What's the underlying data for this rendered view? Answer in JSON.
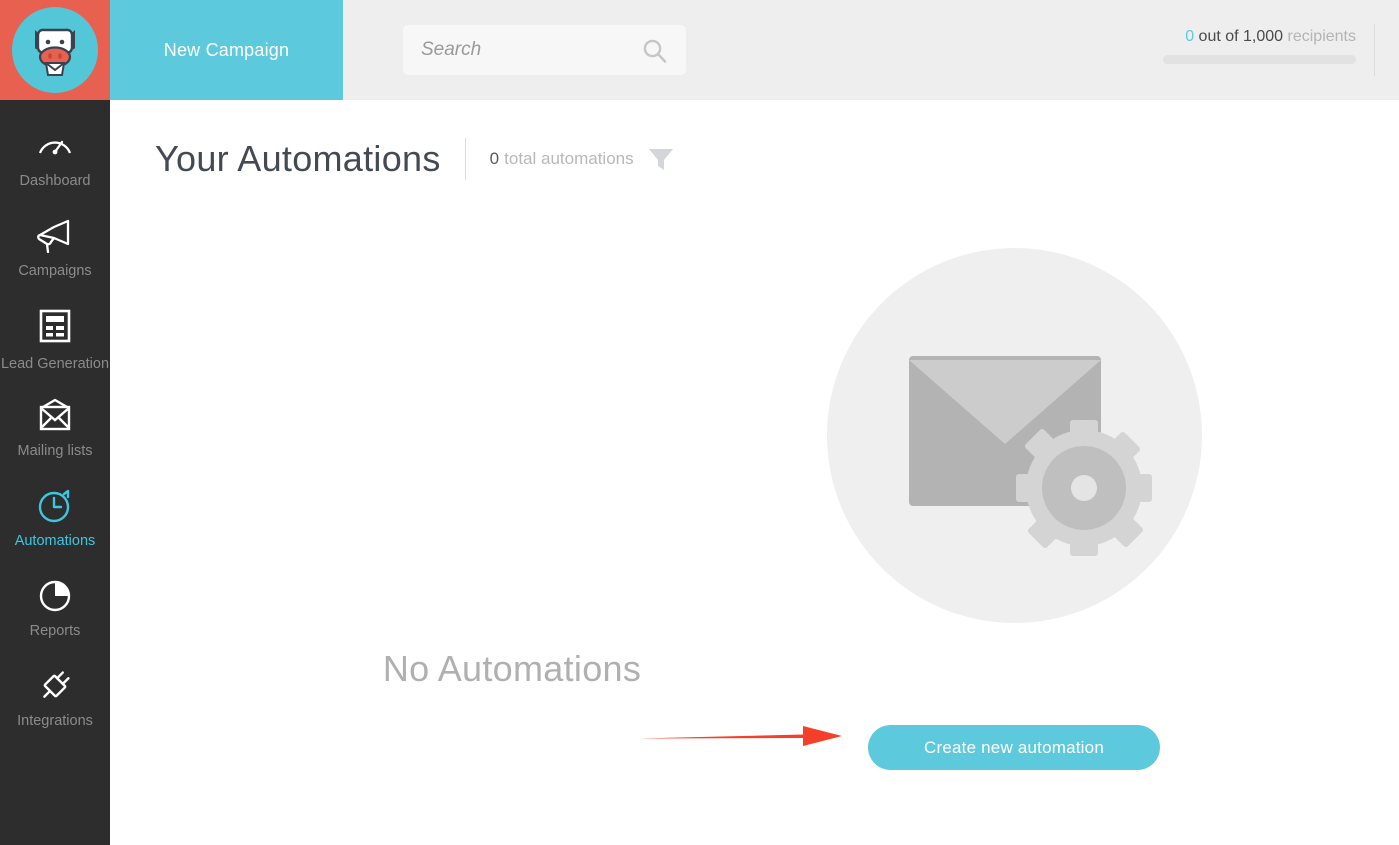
{
  "header": {
    "logo": {
      "icon": "cow-mascot-logo",
      "alt": "Moosend cow logo"
    },
    "new_campaign_label": "New Campaign",
    "search": {
      "placeholder": "Search",
      "value": "",
      "icon": "search-icon"
    },
    "recipients": {
      "count": "0",
      "middle": " out of 1,000 ",
      "unit": "recipients",
      "progress_percent": 0
    }
  },
  "sidebar": {
    "items": [
      {
        "label": "Dashboard",
        "icon": "speedometer-icon",
        "active": false
      },
      {
        "label": "Campaigns",
        "icon": "megaphone-icon",
        "active": false
      },
      {
        "label": "Lead Generation",
        "icon": "form-icon",
        "active": false
      },
      {
        "label": "Mailing lists",
        "icon": "envelope-icon",
        "active": false
      },
      {
        "label": "Automations",
        "icon": "stopwatch-icon",
        "active": true
      },
      {
        "label": "Reports",
        "icon": "pie-chart-icon",
        "active": false
      },
      {
        "label": "Integrations",
        "icon": "plug-icon",
        "active": false
      }
    ]
  },
  "main": {
    "page_title": "Your Automations",
    "total_count": "0",
    "total_label": "total automations",
    "filter_icon": "funnel-icon",
    "empty_state": {
      "illustration": "envelope-with-gear-icon",
      "heading": "No Automations",
      "cta_label": "Create new automation"
    },
    "annotation": {
      "type": "arrow",
      "direction": "right",
      "color": "#f4402a"
    }
  },
  "colors": {
    "accent_teal": "#5cc9dd",
    "logo_red": "#e8604f",
    "sidebar_dark": "#2d2d2d",
    "header_gray": "#eeeeee",
    "title_navy": "#434a54",
    "muted_gray": "#b8b8b8",
    "annotation_red": "#f4402a"
  }
}
